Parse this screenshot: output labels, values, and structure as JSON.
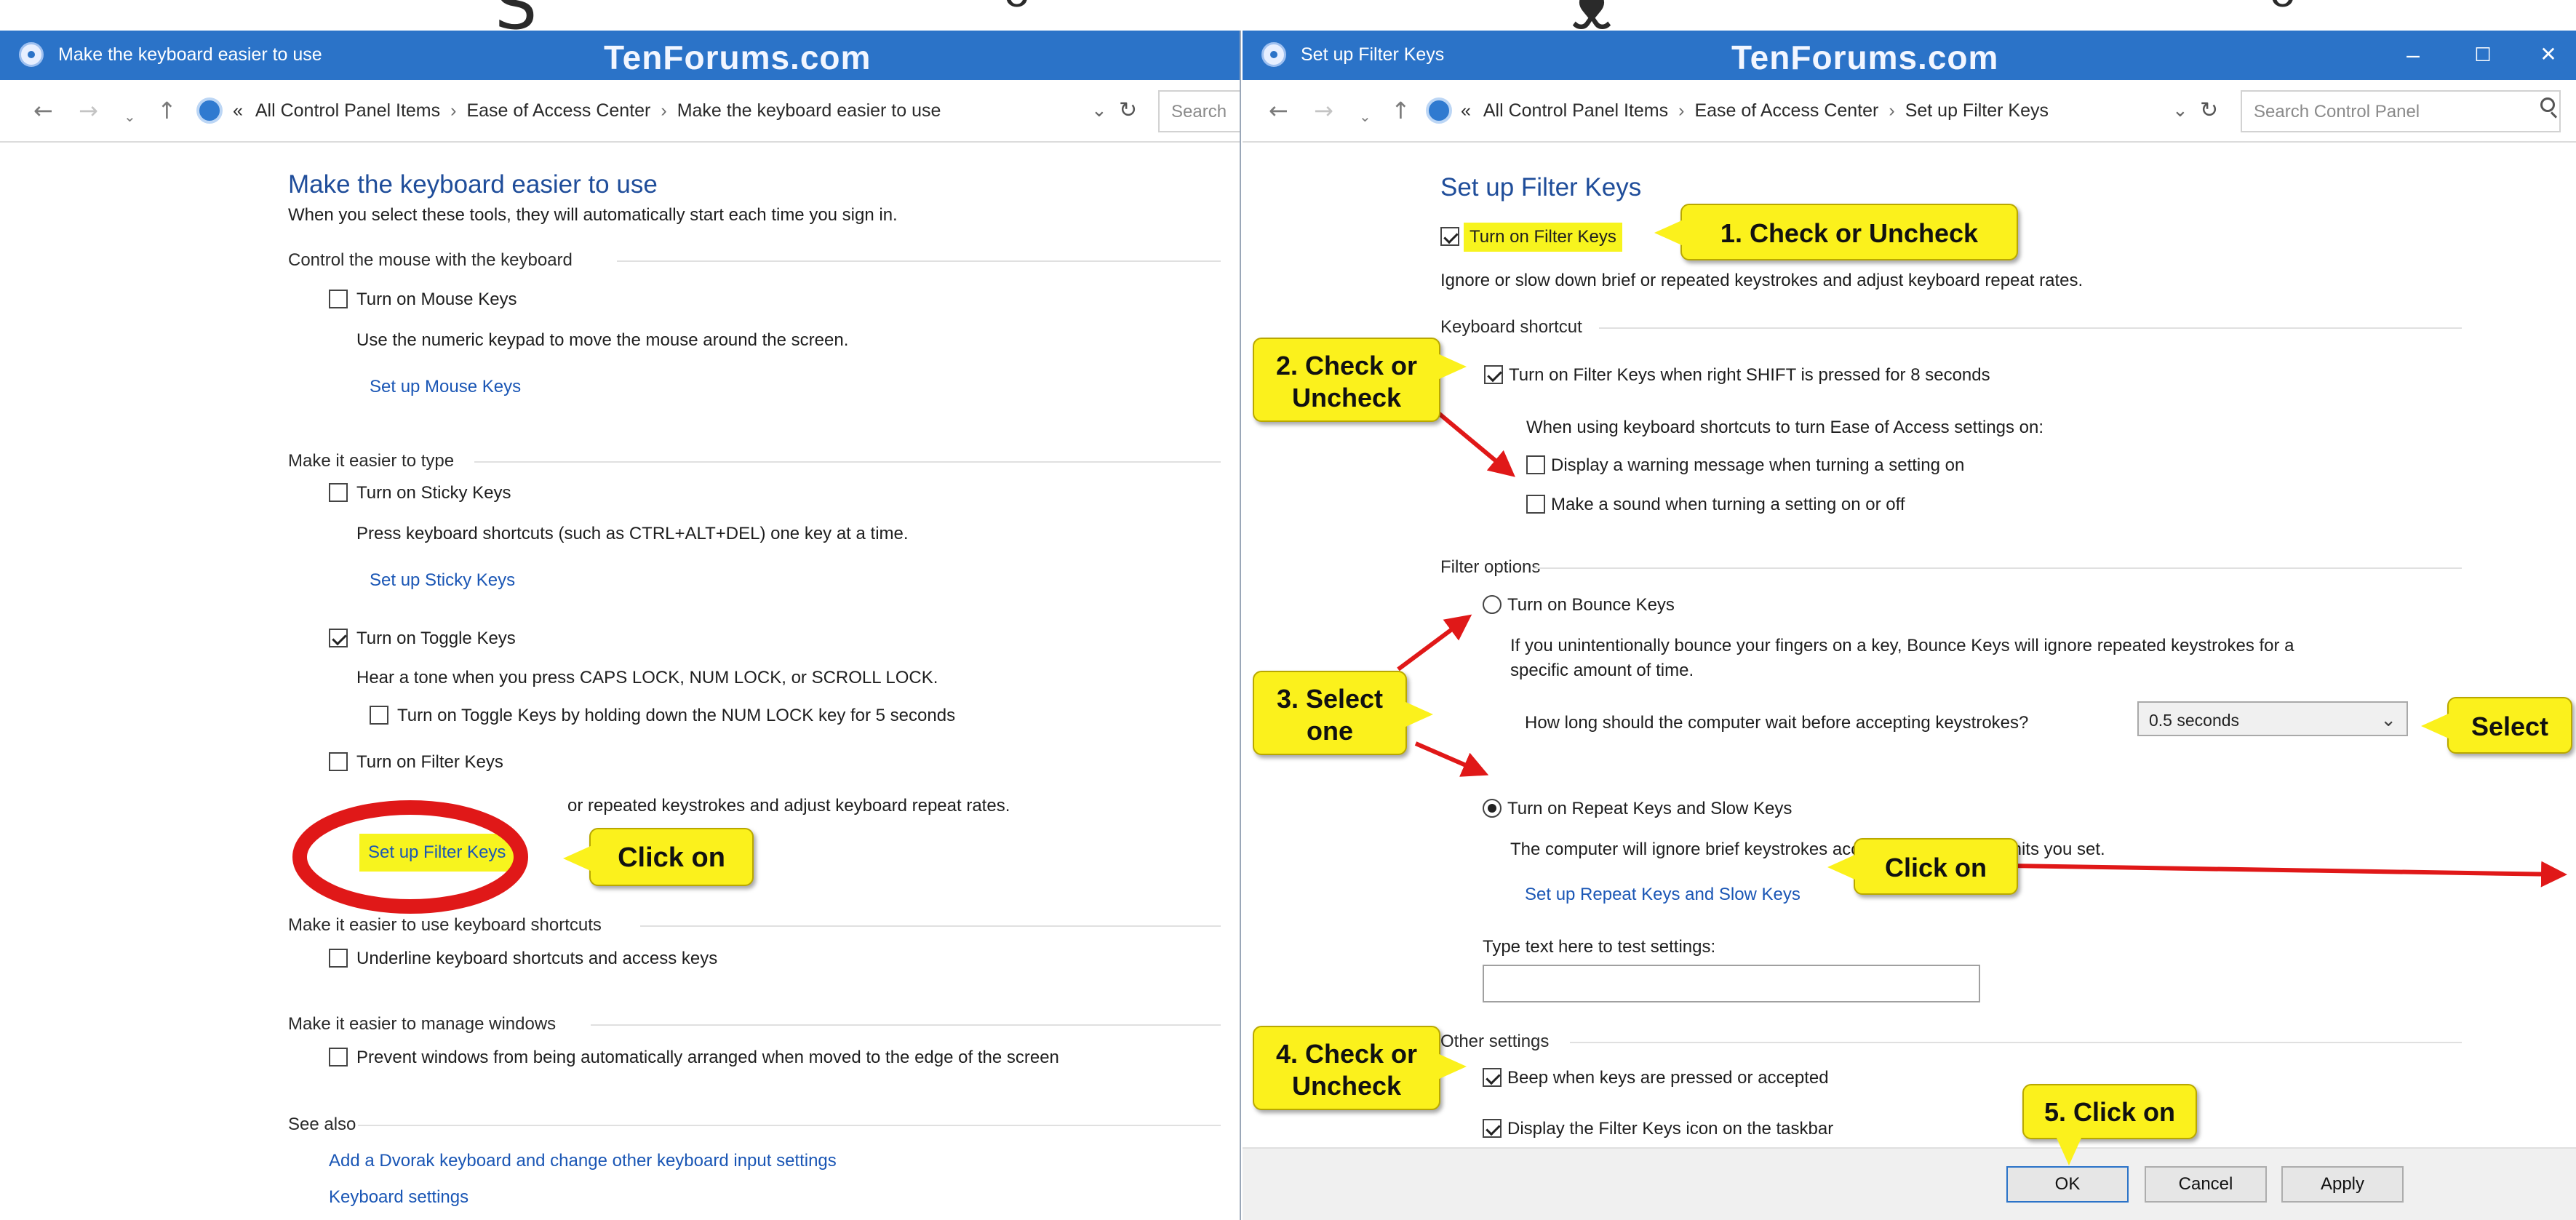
{
  "watermark": "TenForums.com",
  "left_window": {
    "title": "Make the keyboard easier to use",
    "address": {
      "crumb_prefix": "«",
      "crumbs": [
        "All Control Panel Items",
        "Ease of Access Center",
        "Make the keyboard easier to use"
      ],
      "search_placeholder": "Search"
    },
    "page_title": "Make the keyboard easier to use",
    "intro": "When you select these tools, they will automatically start each time you sign in.",
    "sections": {
      "mouse": {
        "heading": "Control the mouse with the keyboard",
        "mouse_keys": {
          "label": "Turn on Mouse Keys",
          "checked": false
        },
        "mouse_keys_desc": "Use the numeric keypad to move the mouse around the screen.",
        "mouse_keys_link": "Set up Mouse Keys"
      },
      "typing": {
        "heading": "Make it easier to type",
        "sticky": {
          "label": "Turn on Sticky Keys",
          "checked": false
        },
        "sticky_desc": "Press keyboard shortcuts (such as CTRL+ALT+DEL) one key at a time.",
        "sticky_link": "Set up Sticky Keys",
        "toggle": {
          "label": "Turn on Toggle Keys",
          "checked": true
        },
        "toggle_desc": "Hear a tone when you press CAPS LOCK, NUM LOCK, or SCROLL LOCK.",
        "toggle_numlock": {
          "label": "Turn on Toggle Keys by holding down the NUM LOCK key for 5 seconds",
          "checked": false
        },
        "filter": {
          "label": "Turn on Filter Keys",
          "checked": false
        },
        "filter_desc": "or repeated keystrokes and adjust keyboard repeat rates.",
        "filter_link": "Set up Filter Keys"
      },
      "shortcuts": {
        "heading": "Make it easier to use keyboard shortcuts",
        "underline": {
          "label": "Underline keyboard shortcuts and access keys",
          "checked": false
        }
      },
      "windows": {
        "heading": "Make it easier to manage windows",
        "prevent": {
          "label": "Prevent windows from being automatically arranged when moved to the edge of the screen",
          "checked": false
        }
      },
      "see_also": {
        "heading": "See also",
        "links": [
          "Add a Dvorak keyboard and change other keyboard input settings",
          "Keyboard settings"
        ]
      }
    }
  },
  "right_window": {
    "title": "Set up Filter Keys",
    "controls": {
      "minimize": "–",
      "maximize": "☐",
      "close": "✕"
    },
    "address": {
      "crumb_prefix": "«",
      "crumbs": [
        "All Control Panel Items",
        "Ease of Access Center",
        "Set up Filter Keys"
      ],
      "search_placeholder": "Search Control Panel"
    },
    "page_title": "Set up Filter Keys",
    "filter_keys": {
      "label": "Turn on Filter Keys",
      "checked": true
    },
    "filter_desc": "Ignore or slow down brief or repeated keystrokes and adjust keyboard repeat rates.",
    "shortcut": {
      "heading": "Keyboard shortcut",
      "shift": {
        "label": "Turn on Filter Keys when right SHIFT is pressed for 8 seconds",
        "checked": true
      },
      "when_using": "When using keyboard shortcuts to turn Ease of Access settings on:",
      "warning": {
        "label": "Display a warning message when turning a setting on",
        "checked": false
      },
      "sound": {
        "label": "Make a sound when turning a setting on or off",
        "checked": false
      }
    },
    "filter_options": {
      "heading": "Filter options",
      "bounce": {
        "label": "Turn on Bounce Keys",
        "selected": false
      },
      "bounce_desc_1": "If you unintentionally bounce your fingers on a key, Bounce Keys will ignore repeated keystrokes for a",
      "bounce_desc_2": "specific amount of time.",
      "wait_label": "How long should the computer wait before accepting keystrokes?",
      "wait_value": "0.5 seconds",
      "repeat": {
        "label": "Turn on Repeat Keys and Slow Keys",
        "selected": true
      },
      "repeat_desc": "The computer will ignore brief keystrokes according to the time limits you set.",
      "repeat_link": "Set up Repeat Keys and Slow Keys",
      "test_label": "Type text here to test settings:",
      "test_value": ""
    },
    "other": {
      "heading": "Other settings",
      "beep": {
        "label": "Beep when keys are pressed or accepted",
        "checked": true
      },
      "icon": {
        "label": "Display the Filter Keys icon on the taskbar",
        "checked": true
      }
    },
    "buttons": {
      "ok": "OK",
      "cancel": "Cancel",
      "apply": "Apply"
    }
  },
  "annotations": {
    "step1": "1. Check or Uncheck",
    "step2_l1": "2. Check or",
    "step2_l2": "Uncheck",
    "step3_l1": "3. Select",
    "step3_l2": "one",
    "step4_l1": "4. Check or",
    "step4_l2": "Uncheck",
    "step5": "5. Click on",
    "select": "Select",
    "click_on_left": "Click on",
    "click_on_right": "Click on"
  },
  "colors": {
    "titlebar": "#2b73c8",
    "link": "#1a56b5",
    "heading": "#1f4d9a",
    "highlight": "#f7f41e",
    "callout": "#fbf11c",
    "arrow": "#e01818"
  }
}
